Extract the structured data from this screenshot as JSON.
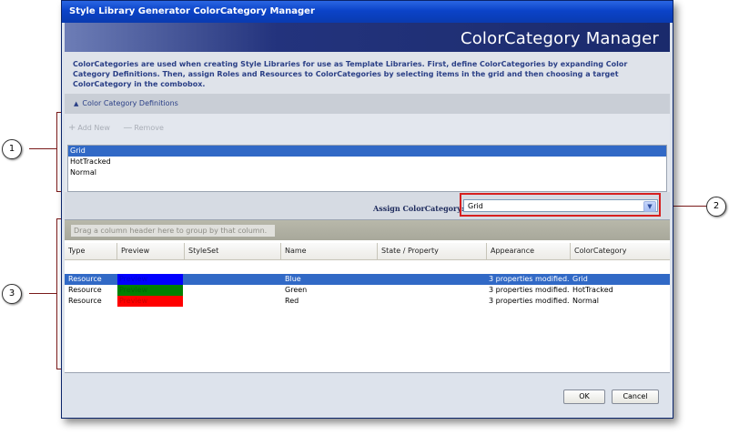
{
  "window": {
    "title": "Style Library Generator ColorCategory Manager",
    "header_title": "ColorCategory Manager",
    "intro_text": "ColorCategories are used when creating Style Libraries for use as Template Libraries. First, define ColorCategories by expanding Color Category Definitions. Then, assign Roles and Resources to ColorCategories by selecting items in the grid and then choosing a target ColorCategory in the combobox."
  },
  "definitions": {
    "section_label": "Color Category Definitions",
    "add_label": "Add New",
    "remove_label": "Remove",
    "items": [
      "Grid",
      "HotTracked",
      "Normal"
    ],
    "selected": "Grid"
  },
  "assign": {
    "label": "Assign ColorCategory:",
    "value": "Grid"
  },
  "grid": {
    "group_hint": "Drag a column header here to group by that column.",
    "columns": [
      "Type",
      "Preview",
      "StyleSet",
      "Name",
      "State / Property",
      "Appearance",
      "ColorCategory"
    ],
    "rows": [
      {
        "type": "Resource",
        "preview": "Preview",
        "preview_color": "#0000ff",
        "styleset": "",
        "name": "Blue",
        "state": "",
        "appearance": "3 properties modified.",
        "category": "Grid"
      },
      {
        "type": "Resource",
        "preview": "Preview",
        "preview_color": "#008000",
        "styleset": "",
        "name": "Green",
        "state": "",
        "appearance": "3 properties modified.",
        "category": "HotTracked"
      },
      {
        "type": "Resource",
        "preview": "Preview",
        "preview_color": "#ff0000",
        "styleset": "",
        "name": "Red",
        "state": "",
        "appearance": "3 properties modified.",
        "category": "Normal"
      }
    ]
  },
  "buttons": {
    "ok": "OK",
    "cancel": "Cancel"
  },
  "callouts": [
    "1",
    "2",
    "3"
  ],
  "icons": {
    "add": "plus-icon",
    "remove": "minus-icon",
    "collapse": "chevron-up-icon",
    "dropdown": "chevron-down-icon"
  }
}
